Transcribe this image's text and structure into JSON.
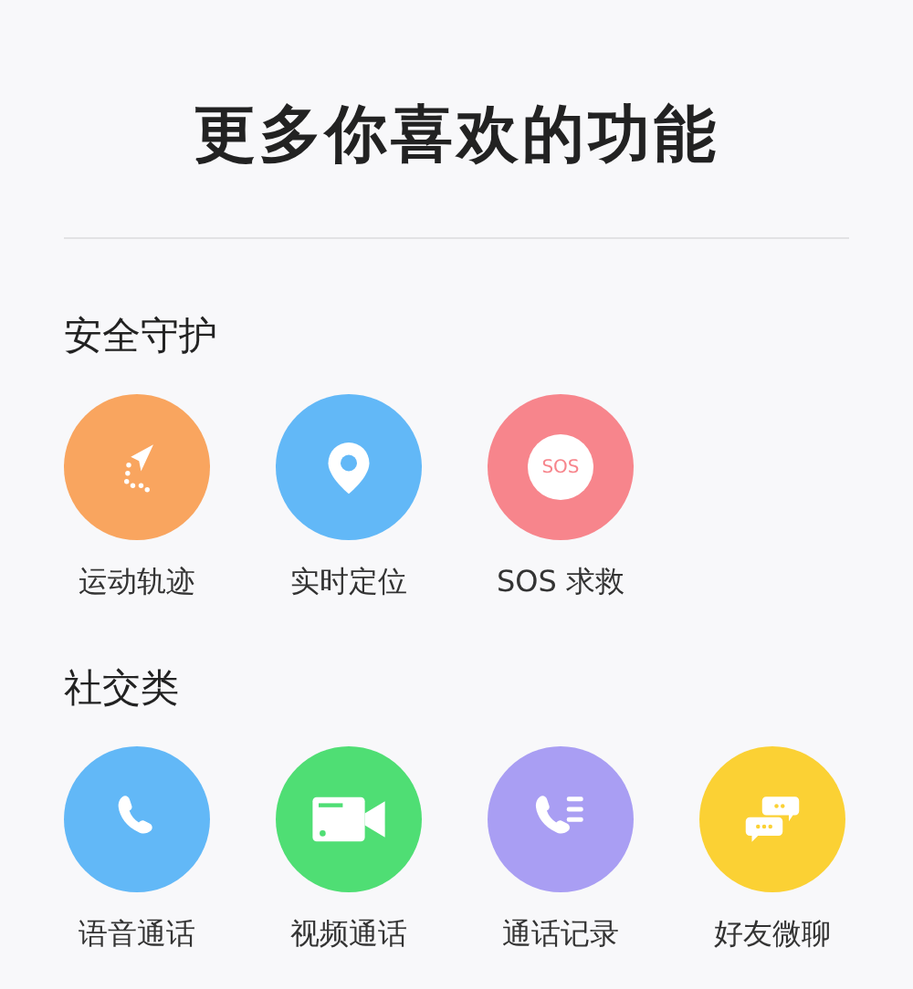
{
  "title": "更多你喜欢的功能",
  "sections": [
    {
      "heading": "安全守护",
      "items": [
        {
          "label": "运动轨迹",
          "kind": "route",
          "color": "#f9a55f"
        },
        {
          "label": "实时定位",
          "kind": "pin",
          "color": "#62b8f7"
        },
        {
          "label": "SOS 求救",
          "kind": "sos",
          "color": "#f7858c",
          "badge": "SOS"
        }
      ]
    },
    {
      "heading": "社交类",
      "items": [
        {
          "label": "语音通话",
          "kind": "phone",
          "color": "#62b8f7"
        },
        {
          "label": "视频通话",
          "kind": "video",
          "color": "#4fde74"
        },
        {
          "label": "通话记录",
          "kind": "calllog",
          "color": "#a99ef3"
        },
        {
          "label": "好友微聊",
          "kind": "chat",
          "color": "#fbd134"
        }
      ]
    }
  ]
}
